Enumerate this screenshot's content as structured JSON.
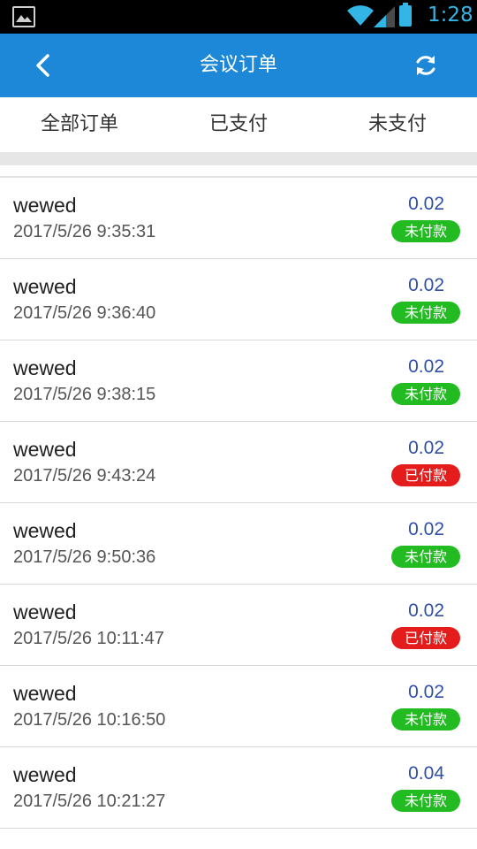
{
  "status_bar": {
    "time": "1:28",
    "icons": [
      "image-icon",
      "wifi-icon",
      "signal-icon",
      "battery-icon"
    ]
  },
  "header": {
    "title": "会议订单",
    "back_icon": "chevron-left-icon",
    "refresh_icon": "refresh-icon",
    "color": "#1e88d8"
  },
  "tabs": [
    {
      "label": "全部订单"
    },
    {
      "label": "已支付"
    },
    {
      "label": "未支付"
    }
  ],
  "orders": [
    {
      "name": "wewed",
      "time": "2017/5/26 9:35:31",
      "amount": "0.02",
      "status": "未付款",
      "status_color": "#22bb22"
    },
    {
      "name": "wewed",
      "time": "2017/5/26 9:36:40",
      "amount": "0.02",
      "status": "未付款",
      "status_color": "#22bb22"
    },
    {
      "name": "wewed",
      "time": "2017/5/26 9:38:15",
      "amount": "0.02",
      "status": "未付款",
      "status_color": "#22bb22"
    },
    {
      "name": "wewed",
      "time": "2017/5/26 9:43:24",
      "amount": "0.02",
      "status": "已付款",
      "status_color": "#e51c1c"
    },
    {
      "name": "wewed",
      "time": "2017/5/26 9:50:36",
      "amount": "0.02",
      "status": "未付款",
      "status_color": "#22bb22"
    },
    {
      "name": "wewed",
      "time": "2017/5/26 10:11:47",
      "amount": "0.02",
      "status": "已付款",
      "status_color": "#e51c1c"
    },
    {
      "name": "wewed",
      "time": "2017/5/26 10:16:50",
      "amount": "0.02",
      "status": "未付款",
      "status_color": "#22bb22"
    },
    {
      "name": "wewed",
      "time": "2017/5/26 10:21:27",
      "amount": "0.04",
      "status": "未付款",
      "status_color": "#22bb22"
    }
  ]
}
